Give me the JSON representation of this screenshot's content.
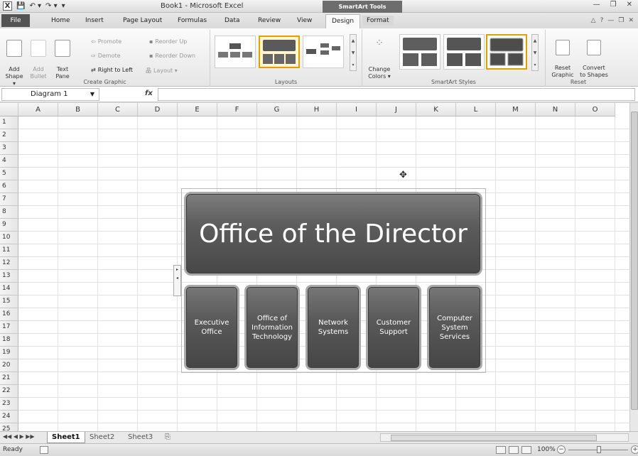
{
  "window": {
    "title": "Book1 - Microsoft Excel",
    "contextual_header": "SmartArt Tools"
  },
  "quick_access": {
    "logo": "X",
    "save": "💾",
    "undo": "↶ ▾",
    "redo": "↷ ▾",
    "customize": "▾"
  },
  "window_controls": {
    "minimize": "—",
    "restore": "❐",
    "close": "✕"
  },
  "ribbon_controls": {
    "minimize_ribbon": "△",
    "help": "?",
    "doc_min": "—",
    "doc_restore": "❐",
    "doc_close": "✕"
  },
  "tabs": [
    {
      "label": "File"
    },
    {
      "label": "Home"
    },
    {
      "label": "Insert"
    },
    {
      "label": "Page Layout"
    },
    {
      "label": "Formulas"
    },
    {
      "label": "Data"
    },
    {
      "label": "Review"
    },
    {
      "label": "View"
    },
    {
      "label": "Design"
    },
    {
      "label": "Format"
    }
  ],
  "ribbon": {
    "create_graphic": {
      "label": "Create Graphic",
      "add_shape": "Add\nShape ▾",
      "add_bullet": "Add\nBullet",
      "text_pane": "Text\nPane",
      "promote": "Promote",
      "demote": "Demote",
      "right_to_left": "Right to Left",
      "reorder_up": "Reorder Up",
      "reorder_down": "Reorder Down",
      "layout": "Layout ▾"
    },
    "layouts": {
      "label": "Layouts"
    },
    "styles": {
      "label": "SmartArt Styles",
      "change_colors": "Change\nColors ▾"
    },
    "reset": {
      "label": "Reset",
      "reset_graphic": "Reset\nGraphic",
      "convert": "Convert\nto Shapes"
    }
  },
  "formula_bar": {
    "name_box": "Diagram 1",
    "fx": "fx",
    "formula": ""
  },
  "columns": [
    "A",
    "B",
    "C",
    "D",
    "E",
    "F",
    "G",
    "H",
    "I",
    "J",
    "K",
    "L",
    "M",
    "N",
    "O"
  ],
  "rows": [
    "1",
    "2",
    "3",
    "4",
    "5",
    "6",
    "7",
    "8",
    "9",
    "10",
    "11",
    "12",
    "13",
    "14",
    "15",
    "16",
    "17",
    "18",
    "19",
    "20",
    "21",
    "22",
    "23",
    "24",
    "25"
  ],
  "smartart": {
    "top": "Office of the Director",
    "children": [
      "Executive\nOffice",
      "Office of\nInformation\nTechnology",
      "Network\nSystems",
      "Customer\nSupport",
      "Computer\nSystem\nServices"
    ]
  },
  "sheets": {
    "nav": "◀◀ ◀ ▶ ▶▶",
    "tabs": [
      "Sheet1",
      "Sheet2",
      "Sheet3"
    ],
    "active": "Sheet1"
  },
  "status": {
    "text": "Ready",
    "zoom": "100%"
  }
}
